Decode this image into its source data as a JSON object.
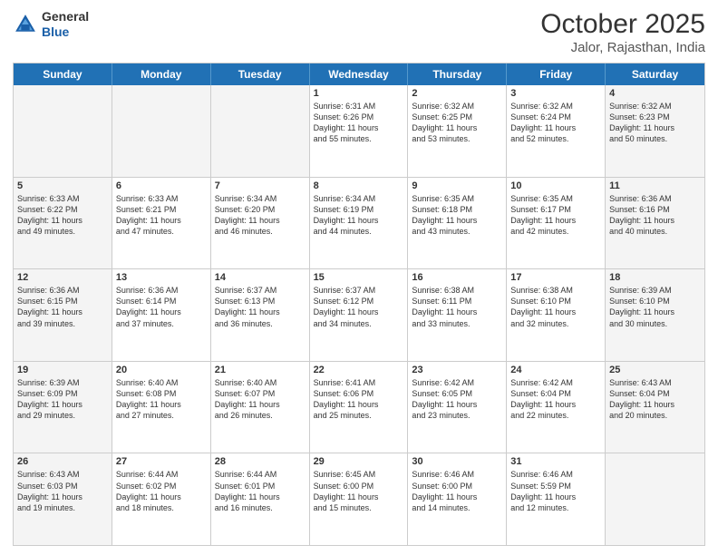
{
  "header": {
    "logo_general": "General",
    "logo_blue": "Blue",
    "month_year": "October 2025",
    "location": "Jalor, Rajasthan, India"
  },
  "days_of_week": [
    "Sunday",
    "Monday",
    "Tuesday",
    "Wednesday",
    "Thursday",
    "Friday",
    "Saturday"
  ],
  "rows": [
    [
      {
        "day": "",
        "info": "",
        "shade": true
      },
      {
        "day": "",
        "info": "",
        "shade": true
      },
      {
        "day": "",
        "info": "",
        "shade": true
      },
      {
        "day": "1",
        "info": "Sunrise: 6:31 AM\nSunset: 6:26 PM\nDaylight: 11 hours\nand 55 minutes.",
        "shade": false
      },
      {
        "day": "2",
        "info": "Sunrise: 6:32 AM\nSunset: 6:25 PM\nDaylight: 11 hours\nand 53 minutes.",
        "shade": false
      },
      {
        "day": "3",
        "info": "Sunrise: 6:32 AM\nSunset: 6:24 PM\nDaylight: 11 hours\nand 52 minutes.",
        "shade": false
      },
      {
        "day": "4",
        "info": "Sunrise: 6:32 AM\nSunset: 6:23 PM\nDaylight: 11 hours\nand 50 minutes.",
        "shade": true
      }
    ],
    [
      {
        "day": "5",
        "info": "Sunrise: 6:33 AM\nSunset: 6:22 PM\nDaylight: 11 hours\nand 49 minutes.",
        "shade": true
      },
      {
        "day": "6",
        "info": "Sunrise: 6:33 AM\nSunset: 6:21 PM\nDaylight: 11 hours\nand 47 minutes.",
        "shade": false
      },
      {
        "day": "7",
        "info": "Sunrise: 6:34 AM\nSunset: 6:20 PM\nDaylight: 11 hours\nand 46 minutes.",
        "shade": false
      },
      {
        "day": "8",
        "info": "Sunrise: 6:34 AM\nSunset: 6:19 PM\nDaylight: 11 hours\nand 44 minutes.",
        "shade": false
      },
      {
        "day": "9",
        "info": "Sunrise: 6:35 AM\nSunset: 6:18 PM\nDaylight: 11 hours\nand 43 minutes.",
        "shade": false
      },
      {
        "day": "10",
        "info": "Sunrise: 6:35 AM\nSunset: 6:17 PM\nDaylight: 11 hours\nand 42 minutes.",
        "shade": false
      },
      {
        "day": "11",
        "info": "Sunrise: 6:36 AM\nSunset: 6:16 PM\nDaylight: 11 hours\nand 40 minutes.",
        "shade": true
      }
    ],
    [
      {
        "day": "12",
        "info": "Sunrise: 6:36 AM\nSunset: 6:15 PM\nDaylight: 11 hours\nand 39 minutes.",
        "shade": true
      },
      {
        "day": "13",
        "info": "Sunrise: 6:36 AM\nSunset: 6:14 PM\nDaylight: 11 hours\nand 37 minutes.",
        "shade": false
      },
      {
        "day": "14",
        "info": "Sunrise: 6:37 AM\nSunset: 6:13 PM\nDaylight: 11 hours\nand 36 minutes.",
        "shade": false
      },
      {
        "day": "15",
        "info": "Sunrise: 6:37 AM\nSunset: 6:12 PM\nDaylight: 11 hours\nand 34 minutes.",
        "shade": false
      },
      {
        "day": "16",
        "info": "Sunrise: 6:38 AM\nSunset: 6:11 PM\nDaylight: 11 hours\nand 33 minutes.",
        "shade": false
      },
      {
        "day": "17",
        "info": "Sunrise: 6:38 AM\nSunset: 6:10 PM\nDaylight: 11 hours\nand 32 minutes.",
        "shade": false
      },
      {
        "day": "18",
        "info": "Sunrise: 6:39 AM\nSunset: 6:10 PM\nDaylight: 11 hours\nand 30 minutes.",
        "shade": true
      }
    ],
    [
      {
        "day": "19",
        "info": "Sunrise: 6:39 AM\nSunset: 6:09 PM\nDaylight: 11 hours\nand 29 minutes.",
        "shade": true
      },
      {
        "day": "20",
        "info": "Sunrise: 6:40 AM\nSunset: 6:08 PM\nDaylight: 11 hours\nand 27 minutes.",
        "shade": false
      },
      {
        "day": "21",
        "info": "Sunrise: 6:40 AM\nSunset: 6:07 PM\nDaylight: 11 hours\nand 26 minutes.",
        "shade": false
      },
      {
        "day": "22",
        "info": "Sunrise: 6:41 AM\nSunset: 6:06 PM\nDaylight: 11 hours\nand 25 minutes.",
        "shade": false
      },
      {
        "day": "23",
        "info": "Sunrise: 6:42 AM\nSunset: 6:05 PM\nDaylight: 11 hours\nand 23 minutes.",
        "shade": false
      },
      {
        "day": "24",
        "info": "Sunrise: 6:42 AM\nSunset: 6:04 PM\nDaylight: 11 hours\nand 22 minutes.",
        "shade": false
      },
      {
        "day": "25",
        "info": "Sunrise: 6:43 AM\nSunset: 6:04 PM\nDaylight: 11 hours\nand 20 minutes.",
        "shade": true
      }
    ],
    [
      {
        "day": "26",
        "info": "Sunrise: 6:43 AM\nSunset: 6:03 PM\nDaylight: 11 hours\nand 19 minutes.",
        "shade": true
      },
      {
        "day": "27",
        "info": "Sunrise: 6:44 AM\nSunset: 6:02 PM\nDaylight: 11 hours\nand 18 minutes.",
        "shade": false
      },
      {
        "day": "28",
        "info": "Sunrise: 6:44 AM\nSunset: 6:01 PM\nDaylight: 11 hours\nand 16 minutes.",
        "shade": false
      },
      {
        "day": "29",
        "info": "Sunrise: 6:45 AM\nSunset: 6:00 PM\nDaylight: 11 hours\nand 15 minutes.",
        "shade": false
      },
      {
        "day": "30",
        "info": "Sunrise: 6:46 AM\nSunset: 6:00 PM\nDaylight: 11 hours\nand 14 minutes.",
        "shade": false
      },
      {
        "day": "31",
        "info": "Sunrise: 6:46 AM\nSunset: 5:59 PM\nDaylight: 11 hours\nand 12 minutes.",
        "shade": false
      },
      {
        "day": "",
        "info": "",
        "shade": true
      }
    ]
  ]
}
